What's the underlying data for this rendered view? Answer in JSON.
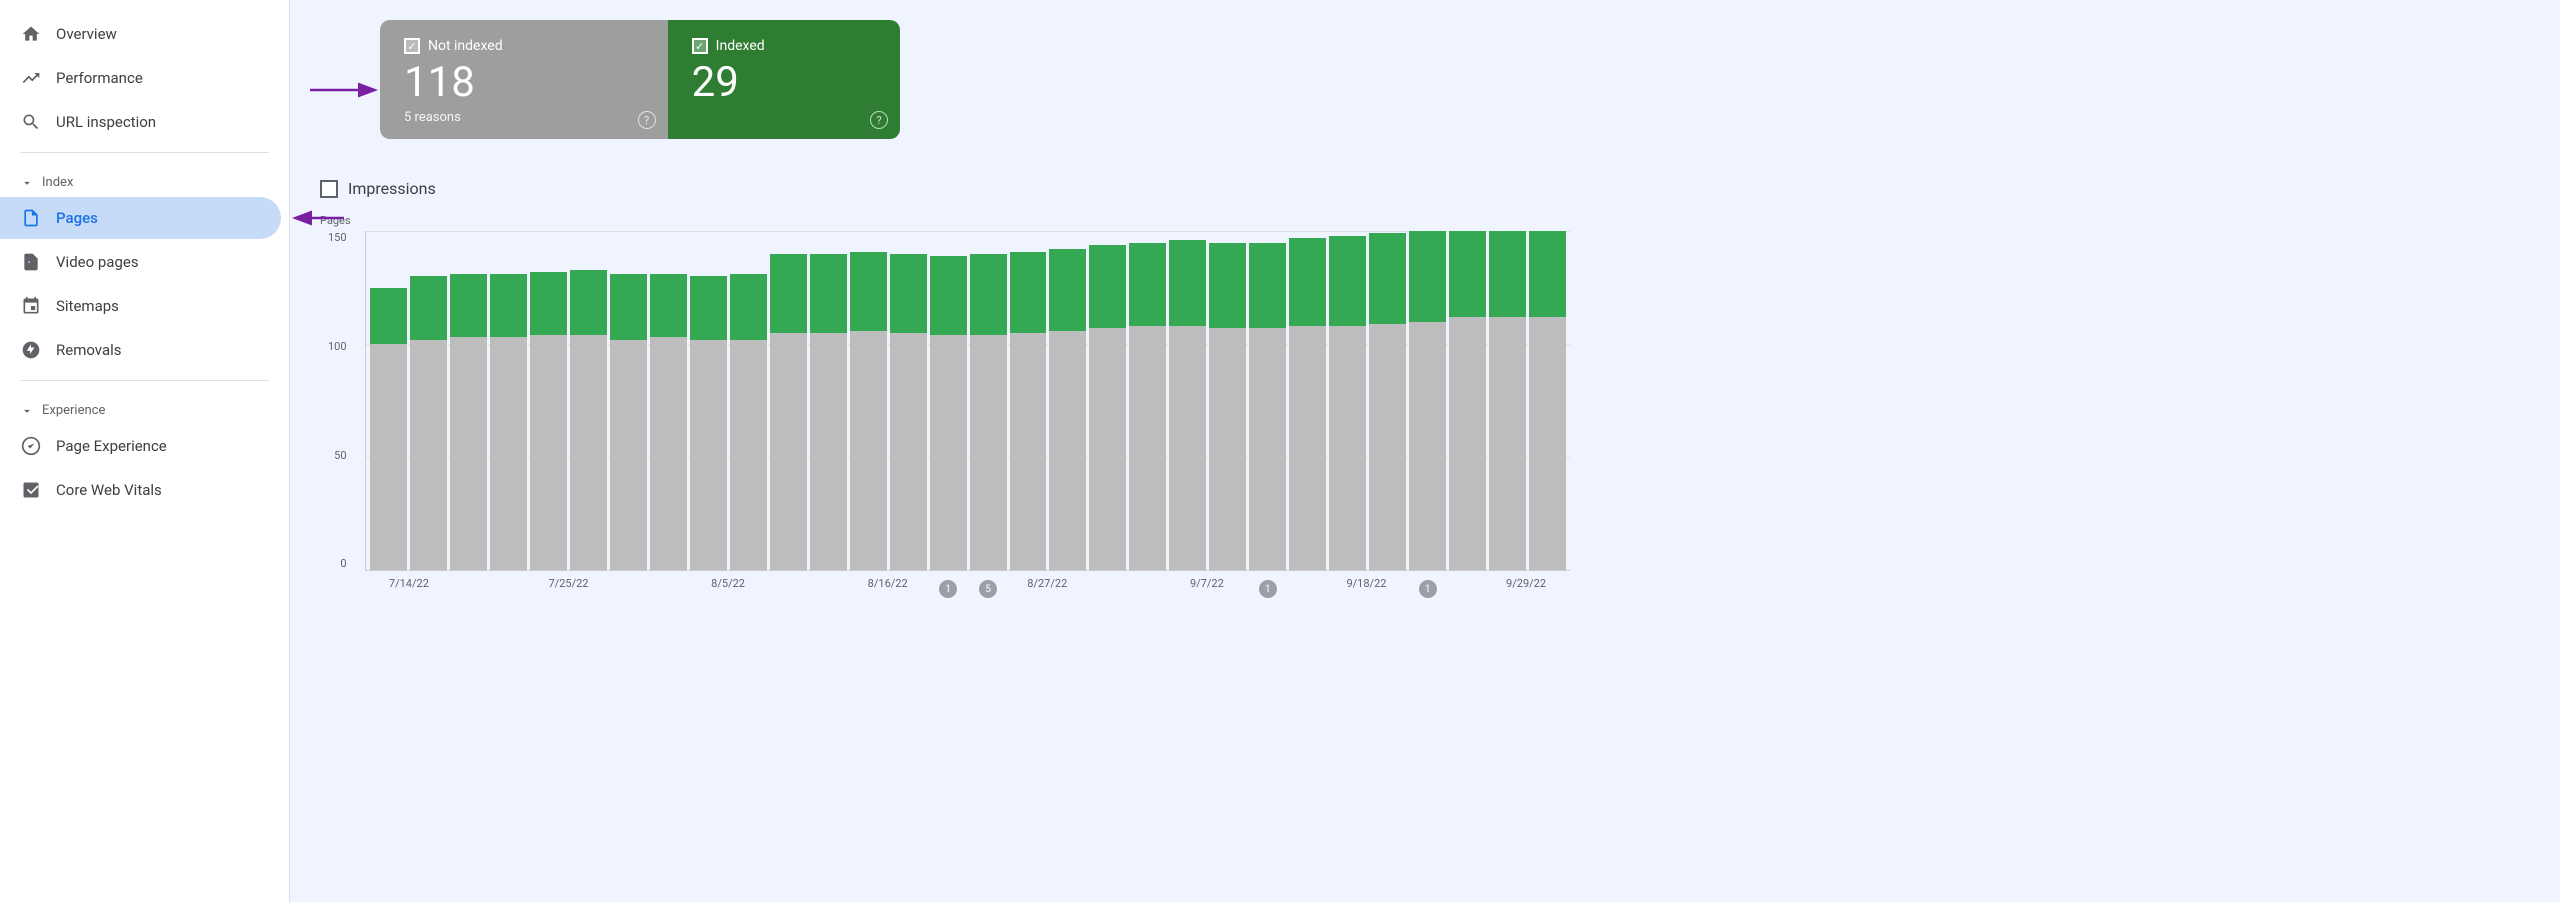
{
  "sidebar": {
    "overview_label": "Overview",
    "performance_label": "Performance",
    "url_inspection_label": "URL inspection",
    "index_section_label": "Index",
    "pages_label": "Pages",
    "video_pages_label": "Video pages",
    "sitemaps_label": "Sitemaps",
    "removals_label": "Removals",
    "experience_section_label": "Experience",
    "page_experience_label": "Page Experience",
    "core_web_vitals_label": "Core Web Vitals"
  },
  "status_cards": {
    "not_indexed_label": "Not indexed",
    "not_indexed_count": "118",
    "not_indexed_sub": "5 reasons",
    "indexed_label": "Indexed",
    "indexed_count": "29",
    "help_symbol": "?"
  },
  "chart": {
    "impressions_label": "Impressions",
    "y_axis_title": "Pages",
    "y_labels": [
      "150",
      "100",
      "50",
      "0"
    ],
    "x_labels": [
      "7/14/22",
      "",
      "7/25/22",
      "",
      "8/5/22",
      "",
      "8/16/22",
      "",
      "8/27/22",
      "",
      "9/7/22",
      "",
      "9/18/22",
      "",
      "9/29/22"
    ],
    "bars": [
      {
        "indexed": 25,
        "not_indexed": 100
      },
      {
        "indexed": 28,
        "not_indexed": 102
      },
      {
        "indexed": 28,
        "not_indexed": 103
      },
      {
        "indexed": 28,
        "not_indexed": 103
      },
      {
        "indexed": 28,
        "not_indexed": 104
      },
      {
        "indexed": 29,
        "not_indexed": 104
      },
      {
        "indexed": 29,
        "not_indexed": 102
      },
      {
        "indexed": 28,
        "not_indexed": 103
      },
      {
        "indexed": 28,
        "not_indexed": 102
      },
      {
        "indexed": 29,
        "not_indexed": 102
      },
      {
        "indexed": 35,
        "not_indexed": 105
      },
      {
        "indexed": 35,
        "not_indexed": 105
      },
      {
        "indexed": 35,
        "not_indexed": 106
      },
      {
        "indexed": 35,
        "not_indexed": 105
      },
      {
        "indexed": 35,
        "not_indexed": 104
      },
      {
        "indexed": 36,
        "not_indexed": 104
      },
      {
        "indexed": 36,
        "not_indexed": 105
      },
      {
        "indexed": 36,
        "not_indexed": 106
      },
      {
        "indexed": 37,
        "not_indexed": 107
      },
      {
        "indexed": 37,
        "not_indexed": 108
      },
      {
        "indexed": 38,
        "not_indexed": 108
      },
      {
        "indexed": 38,
        "not_indexed": 107
      },
      {
        "indexed": 38,
        "not_indexed": 107
      },
      {
        "indexed": 39,
        "not_indexed": 108
      },
      {
        "indexed": 40,
        "not_indexed": 108
      },
      {
        "indexed": 40,
        "not_indexed": 109
      },
      {
        "indexed": 40,
        "not_indexed": 110
      },
      {
        "indexed": 38,
        "not_indexed": 112
      },
      {
        "indexed": 38,
        "not_indexed": 112
      },
      {
        "indexed": 38,
        "not_indexed": 112
      }
    ],
    "max_value": 150,
    "event_markers": [
      {
        "bar_index": 14,
        "label": "1"
      },
      {
        "bar_index": 15,
        "label": "5"
      },
      {
        "bar_index": 22,
        "label": "1"
      },
      {
        "bar_index": 26,
        "label": "1"
      }
    ]
  },
  "colors": {
    "indexed_green": "#34a853",
    "not_indexed_gray": "#bdbdbd",
    "card_not_indexed_bg": "#9e9e9e",
    "card_indexed_bg": "#2e7d32",
    "purple_arrow": "#7b1fa2",
    "active_nav": "#c5dbf7"
  }
}
